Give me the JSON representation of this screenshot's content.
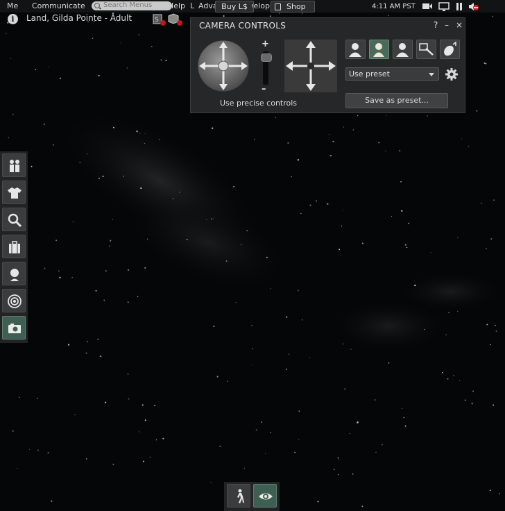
{
  "menu": {
    "me": "Me",
    "communicate": "Communicate",
    "search_placeholder": "Search Menus",
    "help": "Help",
    "advanced": "Advanced",
    "buy_label": "Buy L$",
    "develop": "Develop",
    "shop_label": "Shop",
    "clock": "4:11 AM PST"
  },
  "location": {
    "text": "Land, Gilda Pointe - Adult"
  },
  "camera": {
    "title": "CAMERA CONTROLS",
    "help": "?",
    "minimize": "–",
    "close": "×",
    "zoom_plus": "+",
    "zoom_minus": "–",
    "precise_label": "Use precise controls",
    "preset_value": "Use preset",
    "save_preset": "Save as preset..."
  },
  "icons": {
    "sidebar": [
      "people-icon",
      "appearance-icon",
      "search-icon",
      "inventory-icon",
      "avatar-icon",
      "radar-icon",
      "snapshot-icon"
    ],
    "bottom": [
      "walk-icon",
      "camera-view-icon"
    ],
    "tray": [
      "video-icon",
      "display-icon",
      "pause-icon",
      "volume-muted-icon"
    ]
  },
  "colors": {
    "selected": "#3f5f52",
    "sky": "#050607"
  }
}
